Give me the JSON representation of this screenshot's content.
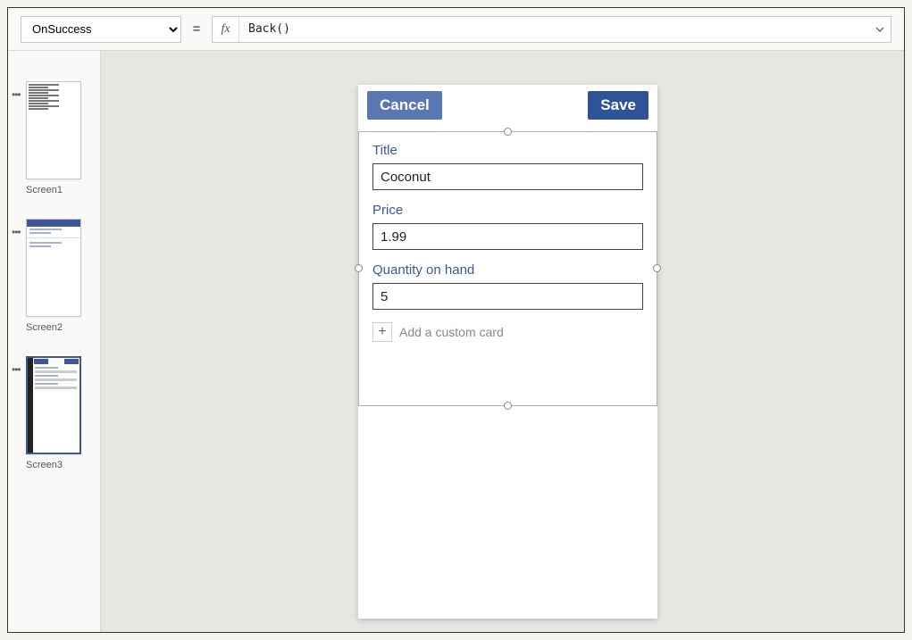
{
  "formulaBar": {
    "property": "OnSuccess",
    "equals": "=",
    "fxSymbol": "fx",
    "formula": "Back()"
  },
  "screens": [
    {
      "name": "Screen1"
    },
    {
      "name": "Screen2"
    },
    {
      "name": "Screen3"
    }
  ],
  "appHeader": {
    "cancel": "Cancel",
    "save": "Save"
  },
  "form": {
    "fields": {
      "title": {
        "label": "Title",
        "value": "Coconut"
      },
      "price": {
        "label": "Price",
        "value": "1.99"
      },
      "quantity": {
        "label": "Quantity on hand",
        "value": "5"
      }
    },
    "addCard": "Add a custom card"
  }
}
